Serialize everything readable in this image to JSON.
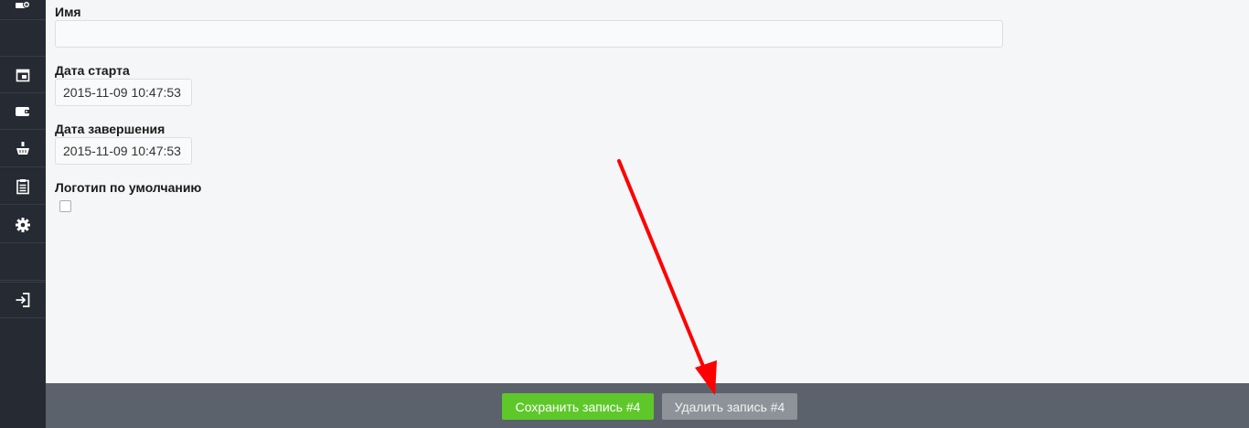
{
  "sidebar": {
    "items": [
      {
        "icon": "user-add-icon"
      },
      {
        "icon": "calendar-icon"
      },
      {
        "icon": "wallet-icon"
      },
      {
        "icon": "basket-icon"
      },
      {
        "icon": "clipboard-icon"
      },
      {
        "icon": "gear-icon"
      },
      {
        "icon": "logout-icon"
      }
    ]
  },
  "form": {
    "name_label": "Имя",
    "name_value": "",
    "start_label": "Дата старта",
    "start_value": "2015-11-09 10:47:53",
    "end_label": "Дата завершения",
    "end_value": "2015-11-09 10:47:53",
    "default_logo_label": "Логотип по умолчанию",
    "default_logo_checked": false
  },
  "footer": {
    "save_label": "Сохранить запись #4",
    "delete_label": "Удалить запись #4"
  },
  "colors": {
    "sidebar_bg": "#262b33",
    "footer_bg": "#5b626b",
    "save_button": "#5ec82a",
    "delete_button": "#8e9399",
    "annotation_arrow": "#ff0000"
  }
}
